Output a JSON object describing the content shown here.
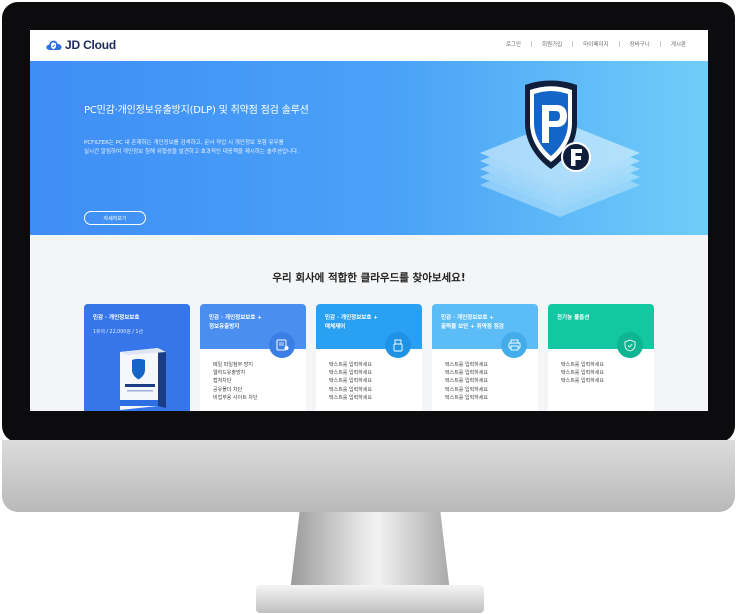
{
  "header": {
    "logo_text": "JD Cloud",
    "nav": [
      "로그인",
      "회원가입",
      "마이페이지",
      "장바구니",
      "게시판"
    ]
  },
  "hero": {
    "title": "PC민감·개인정보유출방지(DLP) 및 취약점 점검 솔루션",
    "desc_line1": "PCFILTER는 PC 내 존재하는 개인정보를 검색하고, 문서 작업 시 개인정보 포함 유무를",
    "desc_line2": "실시간 알림하여 개인정보 침해 위협성을 발견하고 효과적인 대응책을 제시하는 솔루션입니다.",
    "button": "자세히보기"
  },
  "section": {
    "title": "우리 회사에 적합한 클라우드를 찾아보세요!"
  },
  "cards": [
    {
      "title": "민감 · 개인정보보호",
      "sub": "1유저 / 22,000원 / 1년",
      "items": []
    },
    {
      "title": "민감 · 개인정보보호 +",
      "title2": "정보유출방지",
      "items": [
        "메일 파일첨부 방지",
        "웹하드유출방지",
        "캡쳐차단",
        "공유폴더 차단",
        "비업무용 사이트 차단"
      ]
    },
    {
      "title": "민감 · 개인정보보호 +",
      "title2": "매체제어",
      "items": [
        "텍스트를 입력하세요",
        "텍스트를 입력하세요",
        "텍스트를 입력하세요",
        "텍스트를 입력하세요",
        "텍스트를 입력하세요"
      ]
    },
    {
      "title": "민감 · 개인정보보호 +",
      "title2": "출력물 보안 + 취약점 점검",
      "items": [
        "텍스트를 입력하세요",
        "텍스트를 입력하세요",
        "텍스트를 입력하세요",
        "텍스트를 입력하세요",
        "텍스트를 입력하세요"
      ]
    },
    {
      "title": "전기능 풀옵션",
      "items": [
        "텍스트를 입력하세요",
        "텍스트를 입력하세요",
        "텍스트를 입력하세요"
      ]
    }
  ],
  "colors": {
    "card1": "#3676ea",
    "card2": "#4a8ff0",
    "card3": "#2aa0f2",
    "card4": "#5cbcf6",
    "card5": "#12c7a1"
  },
  "icons": [
    "cloud-logo-icon",
    "shield-pf-icon",
    "card-icon-doc",
    "card-icon-usb",
    "card-icon-printer",
    "card-icon-shield"
  ]
}
